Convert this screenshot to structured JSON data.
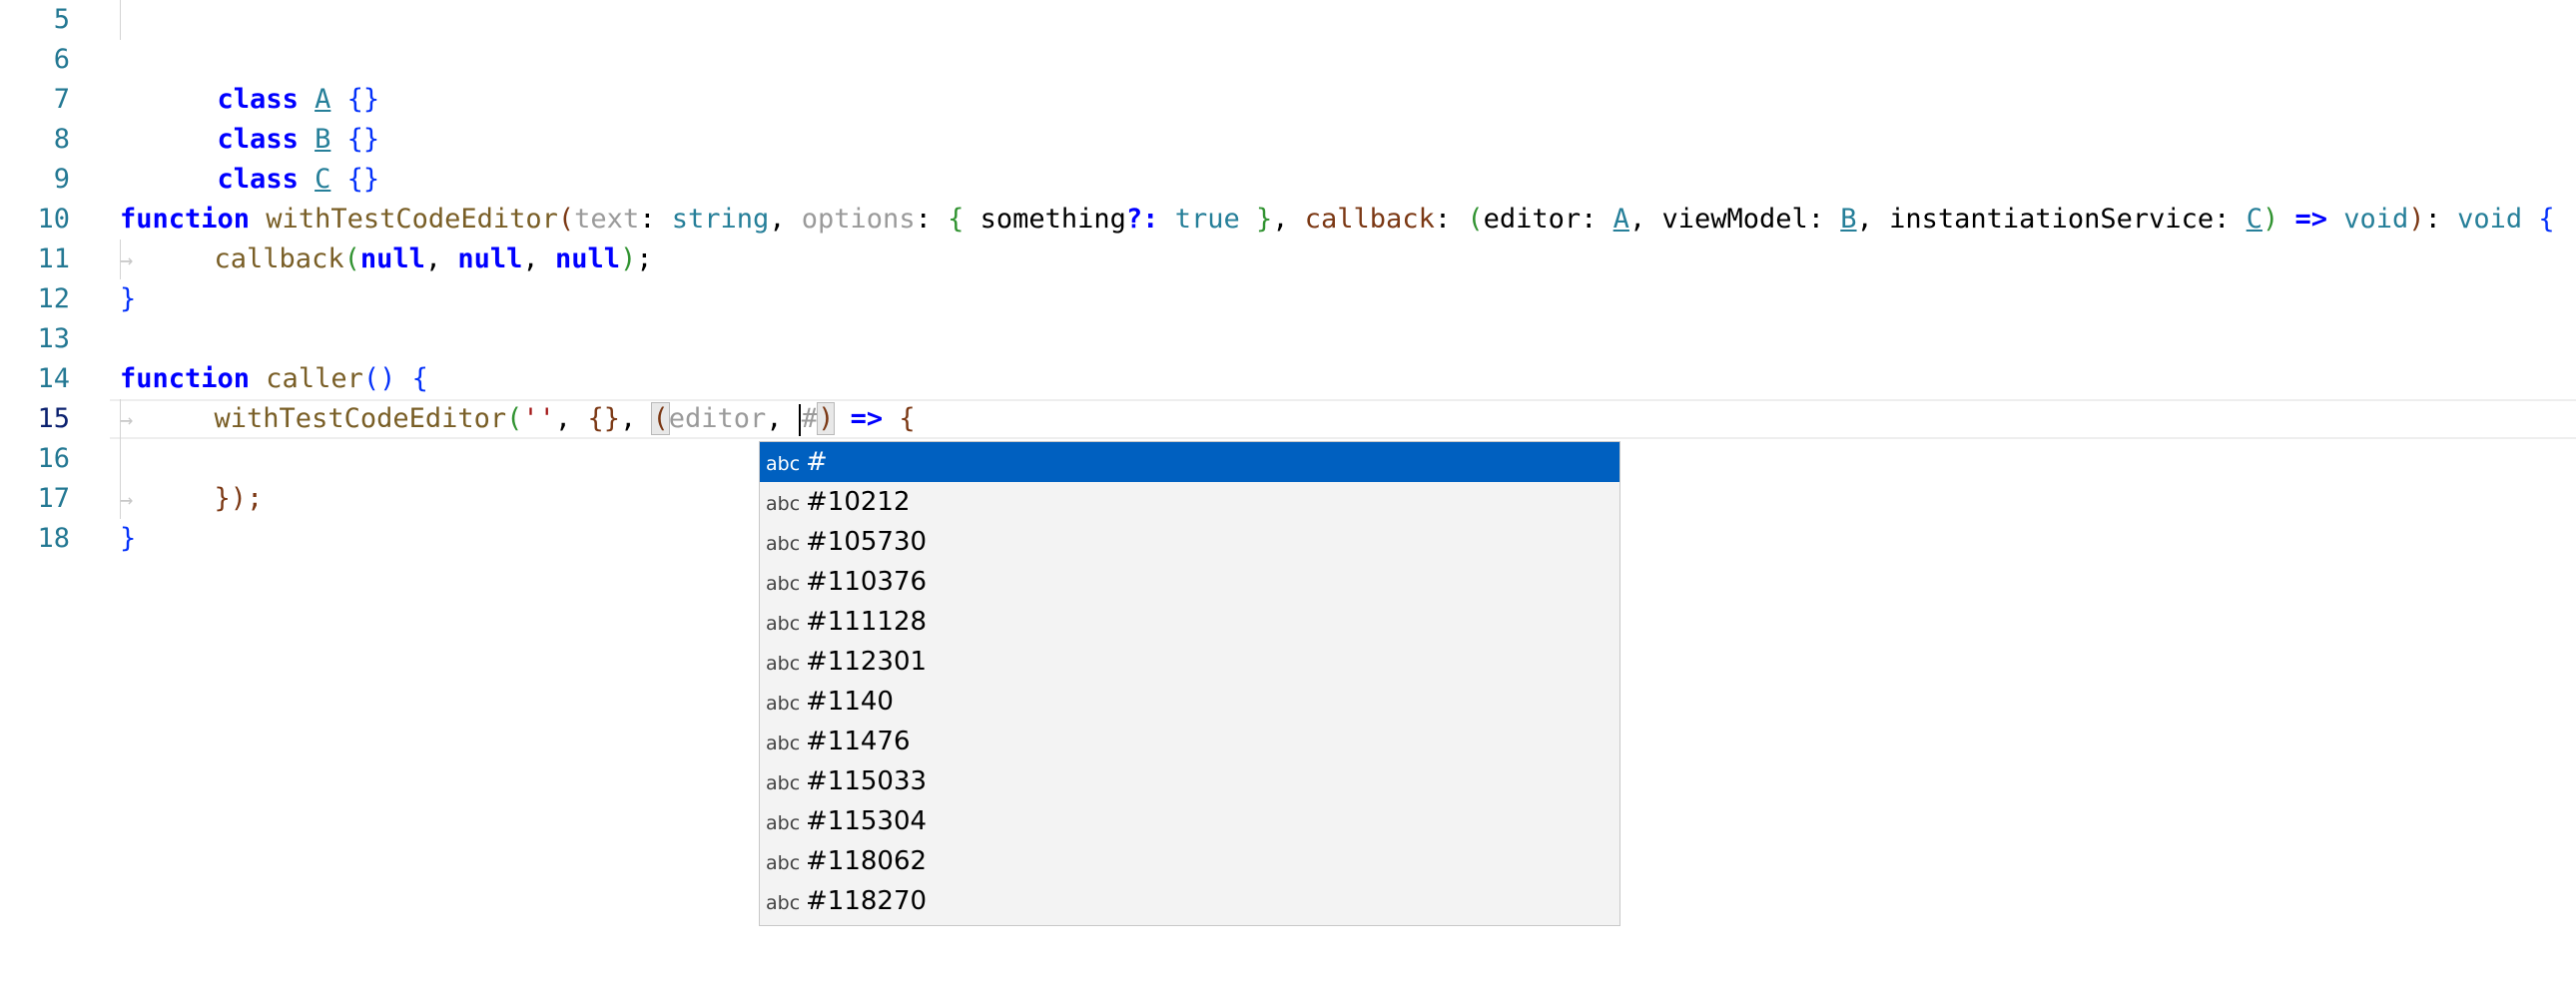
{
  "line_numbers": [
    "5",
    "6",
    "7",
    "8",
    "9",
    "10",
    "11",
    "12",
    "13",
    "14",
    "15",
    "16",
    "17",
    "18"
  ],
  "code": {
    "l6": {
      "kw": "class",
      "name": "A",
      "rest": " {}"
    },
    "l7": {
      "kw": "class",
      "name": "B",
      "rest": " {}"
    },
    "l8": {
      "kw": "class",
      "name": "C",
      "rest": " {}"
    },
    "l10": {
      "kw": "function",
      "fn": " withTestCodeEditor",
      "p1": "text",
      "t1": "string",
      "p2": "options",
      "obj_open": "{",
      "p3": " something",
      "opt": "?:",
      "t3": "true",
      "obj_close": "}",
      "p4": "callback",
      "p5": "editor",
      "t5": "A",
      "p6": "viewModel",
      "t6": "B",
      "p7": "instantiationService",
      "t7": "C",
      "arrow": "=>",
      "t8": "void",
      "t9": "void",
      "open": "{"
    },
    "l11": {
      "arrow_glyph": "→",
      "fn": "callback",
      "a1": "null",
      "a2": "null",
      "a3": "null",
      "end": ");"
    },
    "l12": {
      "close": "}"
    },
    "l14": {
      "kw": "function",
      "fn": " caller",
      "parens": "()",
      "open": " {"
    },
    "l15": {
      "arrow_glyph": "→",
      "fn": "withTestCodeEditor",
      "s": "''",
      "obj": "{}",
      "p": "editor",
      "typed": "#",
      "arrow": "=>",
      "open": "{"
    },
    "l17": {
      "arrow_glyph": "→",
      "close": "});"
    },
    "l18": {
      "close": "}"
    }
  },
  "suggest": {
    "icon_label": "abc",
    "items": [
      "#",
      "#10212",
      "#105730",
      "#110376",
      "#111128",
      "#112301",
      "#1140",
      "#11476",
      "#115033",
      "#115304",
      "#118062",
      "#118270"
    ],
    "selected_index": 0
  },
  "colors": {
    "keyword": "#0000ff",
    "function": "#795e26",
    "type": "#267f99",
    "line_number": "#237893",
    "selection": "#0060c0"
  }
}
